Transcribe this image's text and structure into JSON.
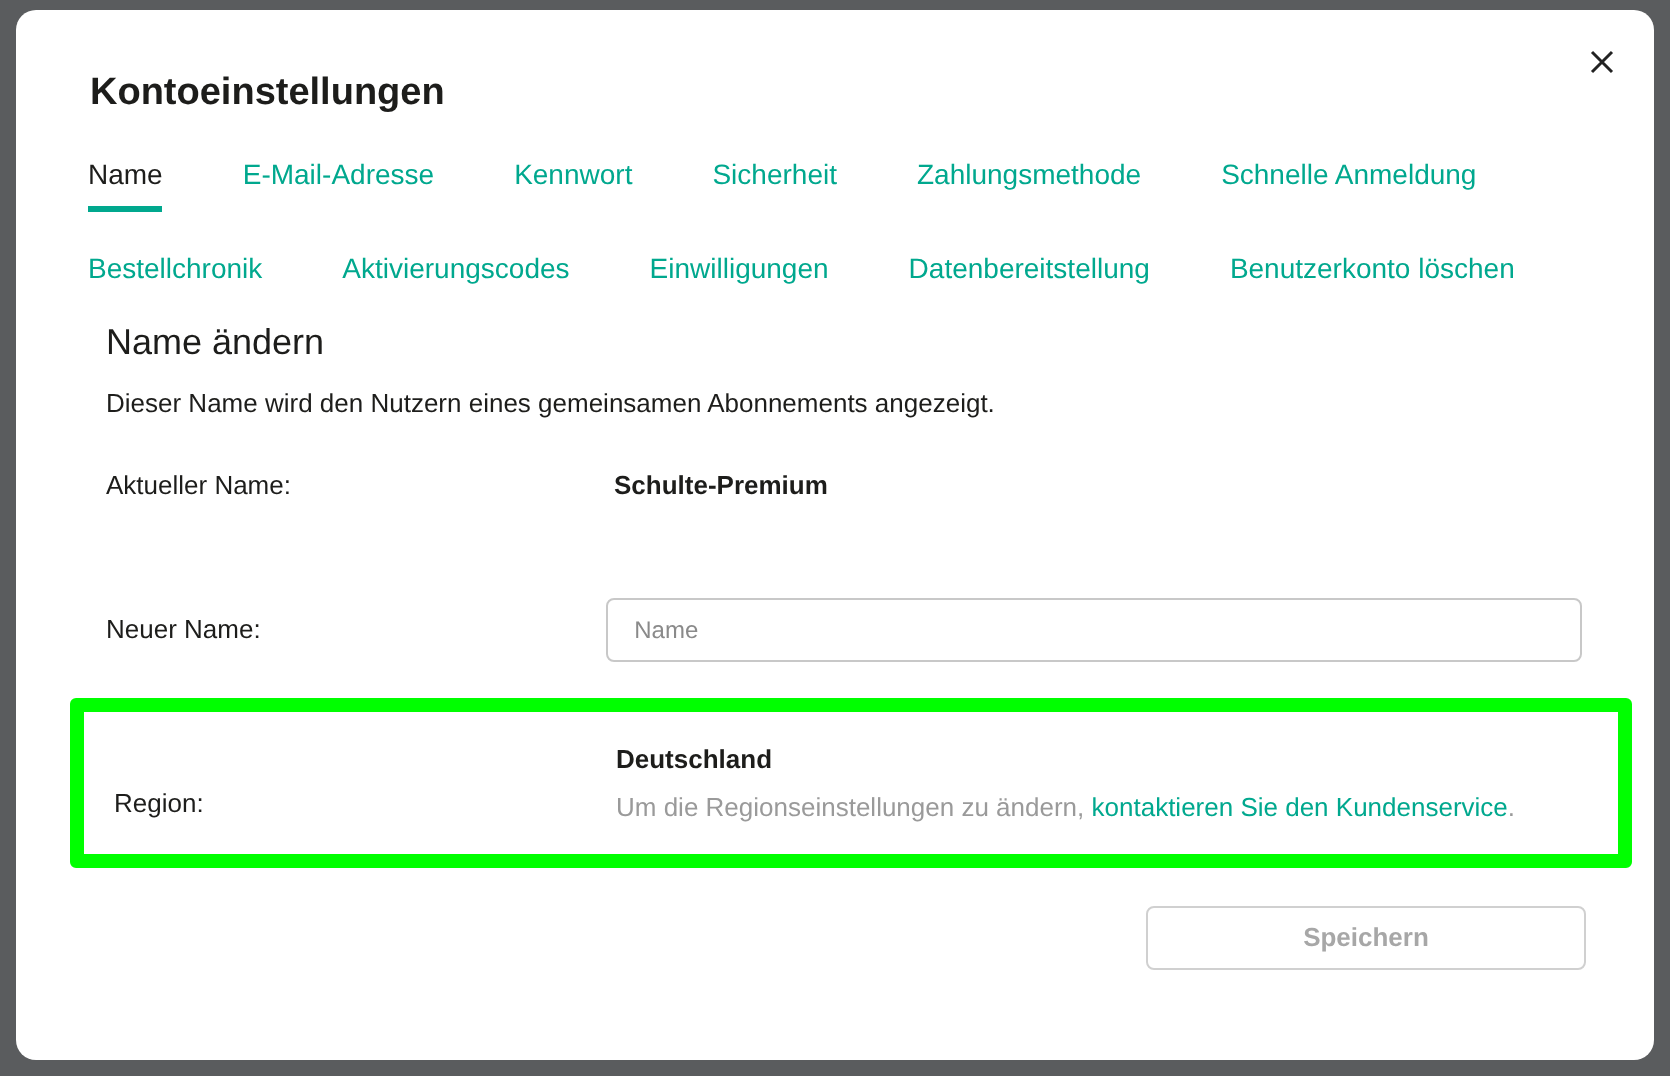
{
  "dialog": {
    "title": "Kontoeinstellungen"
  },
  "tabs": [
    [
      {
        "label": "Name",
        "selected": true
      },
      {
        "label": "E-Mail-Adresse",
        "selected": false
      },
      {
        "label": "Kennwort",
        "selected": false
      },
      {
        "label": "Sicherheit",
        "selected": false
      },
      {
        "label": "Zahlungsmethode",
        "selected": false
      },
      {
        "label": "Schnelle Anmeldung",
        "selected": false
      }
    ],
    [
      {
        "label": "Bestellchronik",
        "selected": false
      },
      {
        "label": "Aktivierungscodes",
        "selected": false
      },
      {
        "label": "Einwilligungen",
        "selected": false
      },
      {
        "label": "Datenbereitstellung",
        "selected": false
      },
      {
        "label": "Benutzerkonto löschen",
        "selected": false
      }
    ]
  ],
  "section": {
    "heading": "Name ändern",
    "description": "Dieser Name wird den Nutzern eines gemeinsamen Abonnements angezeigt."
  },
  "current_name": {
    "label": "Aktueller Name:",
    "value": "Schulte-Premium"
  },
  "new_name": {
    "label": "Neuer Name:",
    "placeholder": "Name"
  },
  "region": {
    "label": "Region:",
    "value": "Deutschland",
    "note_before": "Um die Regionseinstellungen zu ändern, ",
    "link": "kontaktieren Sie den Kundenservice",
    "note_after": ".",
    "highlighted": true
  },
  "save_button": {
    "label": "Speichern",
    "disabled": true
  }
}
